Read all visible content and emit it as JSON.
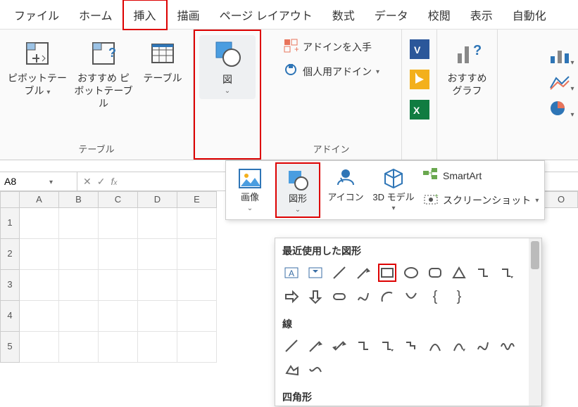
{
  "tabs": [
    "ファイル",
    "ホーム",
    "挿入",
    "描画",
    "ページ レイアウト",
    "数式",
    "データ",
    "校閲",
    "表示",
    "自動化"
  ],
  "active_tab": 2,
  "group_tables": {
    "pivot": "ピボットテーブル",
    "recpivot": "おすすめ\nピボットテーブル",
    "table": "テーブル",
    "label": "テーブル"
  },
  "group_illust": {
    "btn": "図"
  },
  "group_addin": {
    "get": "アドインを入手",
    "my": "個人用アドイン",
    "label": "アドイン"
  },
  "group_chart": {
    "rec": "おすすめ\nグラフ"
  },
  "sub": {
    "image": "画像",
    "shapes": "図形",
    "icons": "アイコン",
    "model3d": "3D\nモデル",
    "smartart": "SmartArt",
    "screenshot": "スクリーンショット"
  },
  "shapes_panel": {
    "recent": "最近使用した図形",
    "lines": "線",
    "rects": "四角形"
  },
  "namebox": "A8",
  "cols": [
    "A",
    "B",
    "C",
    "D",
    "E"
  ],
  "rows": [
    "1",
    "2",
    "3",
    "4",
    "5"
  ],
  "right_col": "O"
}
